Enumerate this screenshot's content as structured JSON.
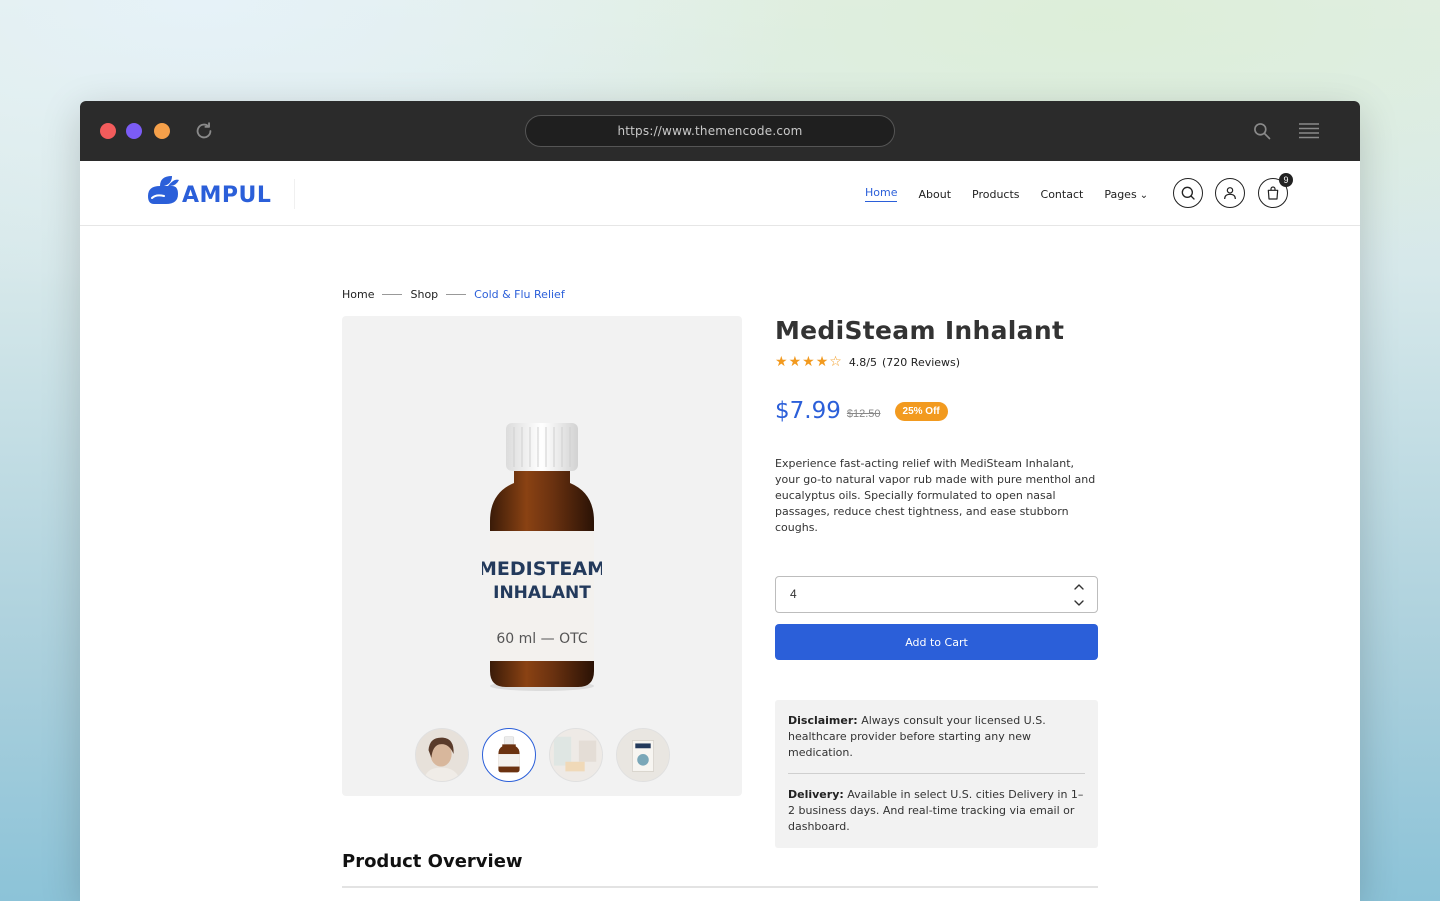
{
  "browser": {
    "url": "https://www.themencode.com",
    "colors": {
      "close": "#f25c5c",
      "minimize": "#7b5cf5",
      "maximize": "#f5a04a"
    }
  },
  "header": {
    "logo_text": "AMPUL",
    "nav": [
      {
        "label": "Home",
        "active": true
      },
      {
        "label": "About",
        "active": false
      },
      {
        "label": "Products",
        "active": false
      },
      {
        "label": "Contact",
        "active": false
      },
      {
        "label": "Pages",
        "active": false,
        "dropdown": true
      }
    ],
    "cart_count": "9",
    "icons": [
      "search-icon",
      "user-icon",
      "cart-icon"
    ]
  },
  "breadcrumb": [
    "Home",
    "Shop",
    "Cold & Flu Relief"
  ],
  "product": {
    "title": "MediSteam Inhalant",
    "rating_stars": 4,
    "rating_stars_max": 5,
    "rating_score": "4.8/5",
    "reviews": "(720 Reviews)",
    "price": "$7.99",
    "old_price": "$12.50",
    "discount": "25% Off",
    "description": "Experience fast-acting relief with MediSteam Inhalant, your go-to natural vapor rub made with pure menthol and eucalyptus oils. Specially formulated to open nasal passages, reduce chest tightness, and ease stubborn coughs.",
    "quantity": "4",
    "add_to_cart": "Add to Cart",
    "label_line1": "MEDISTEAM",
    "label_line2": "INHALANT",
    "label_line3": "60 ml — OTC"
  },
  "notice": {
    "disclaimer_label": "Disclaimer:",
    "disclaimer_text": "Always consult your licensed U.S. healthcare provider before starting any new medication.",
    "delivery_label": "Delivery:",
    "delivery_text": "Available in select U.S. cities Delivery in 1–2 business days. And real-time tracking via email or dashboard."
  },
  "overview": {
    "title": "Product Overview"
  },
  "colors": {
    "accent": "#2b5fd9",
    "badge": "#f29a1f",
    "star": "#f29a1f"
  }
}
